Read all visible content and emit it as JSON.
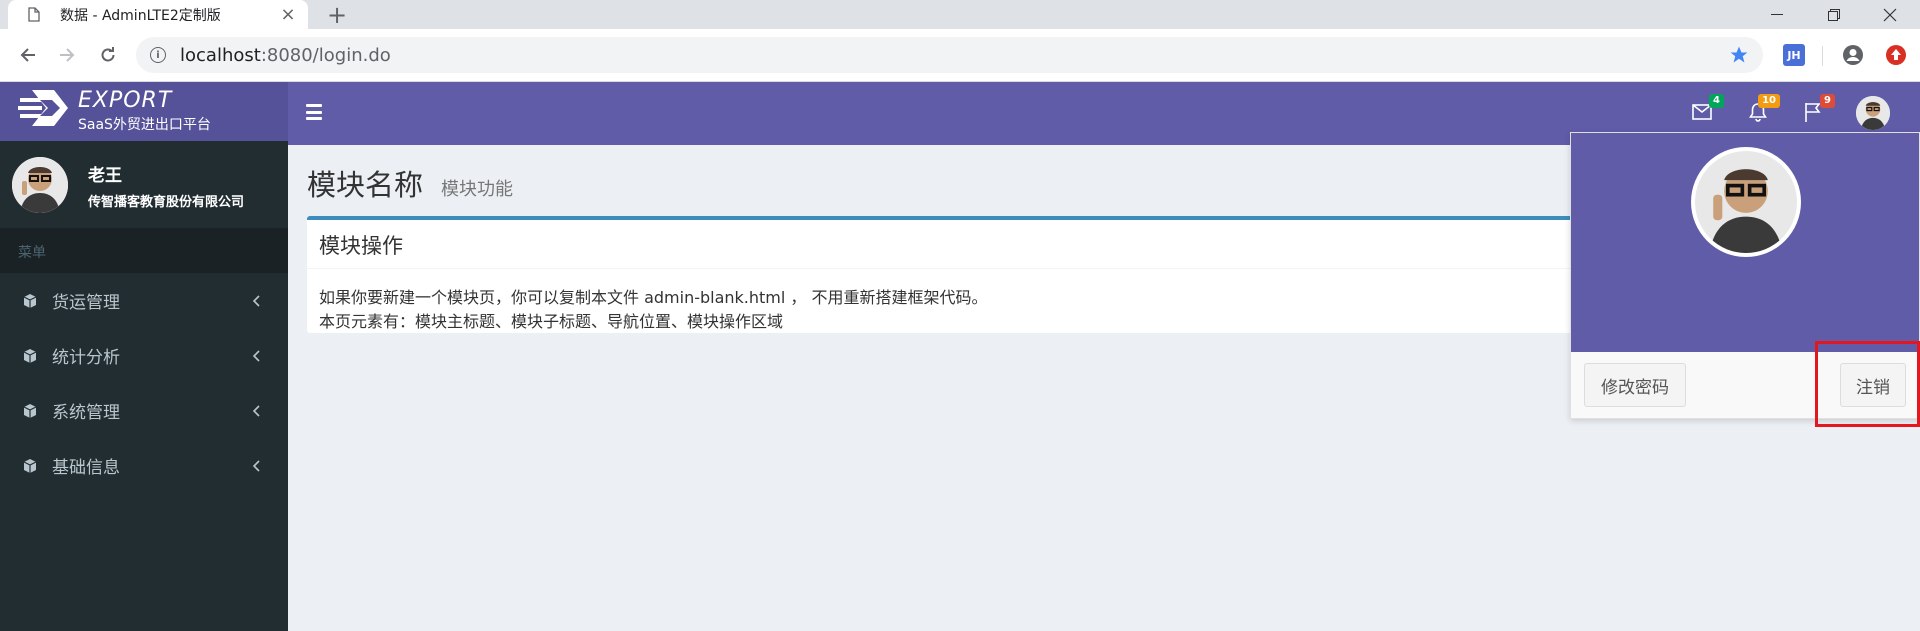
{
  "browser": {
    "tab_title": "数据 - AdminLTE2定制版",
    "url_host": "localhost",
    "url_rest": ":8080/login.do",
    "ext_label": "JH"
  },
  "app": {
    "logo_text": "EXPORT",
    "logo_sub": "SaaS外贸进出口平台",
    "notifications": {
      "messages": "4",
      "alerts": "10",
      "tasks": "9"
    }
  },
  "sidebar": {
    "user_name": "老王",
    "user_org": "传智播客教育股份有限公司",
    "menu_header": "菜单",
    "items": [
      {
        "label": "货运管理"
      },
      {
        "label": "统计分析"
      },
      {
        "label": "系统管理"
      },
      {
        "label": "基础信息"
      }
    ]
  },
  "content": {
    "title": "模块名称",
    "subtitle": "模块功能",
    "box_title": "模块操作",
    "line1": "如果你要新建一个模块页，你可以复制本文件 admin-blank.html ， 不用重新搭建框架代码。",
    "line2": "本页元素有：模块主标题、模块子标题、导航位置、模块操作区域"
  },
  "dropdown": {
    "change_password": "修改密码",
    "logout": "注销"
  },
  "colors": {
    "header": "#605ca8",
    "logo_bg": "#555299",
    "sidebar": "#222d32",
    "box_border": "#3c8dbc",
    "highlight": "#e4161e"
  }
}
